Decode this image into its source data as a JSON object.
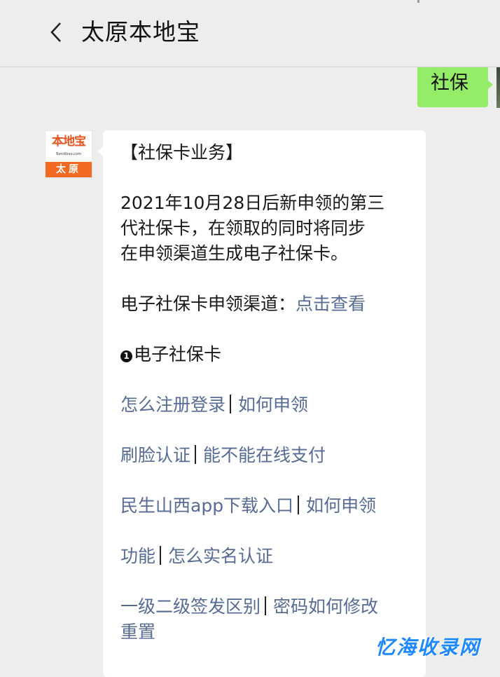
{
  "header": {
    "title": "太原本地宝"
  },
  "chat": {
    "user_message": "社保",
    "bot_avatar": {
      "logo_main": "本地宝",
      "logo_sub": "Bendibao.com",
      "city": "太原"
    },
    "bot_message": {
      "heading": "【社保卡业务】",
      "intro_lines": [
        "2021年10月28日后新申领的第三",
        "代社保卡，在领取的同时将同步",
        "在申领渠道生成电子社保卡。"
      ],
      "channel_label": "电子社保卡申领渠道：",
      "channel_link": "点击查看",
      "section_bullet": "1",
      "section_title": "电子社保卡",
      "links": {
        "how_register": "怎么注册登录",
        "how_apply_1": "如何申领",
        "face_verify": "刷脸认证",
        "online_pay": "能不能在线支付",
        "app_download": "民生山西app下载入口",
        "how_apply_2": "如何申领",
        "features": "功能",
        "realname_verify": "怎么实名认证",
        "level_diff": "一级二级签发区别",
        "password_change_line1": "密码如何修改",
        "password_change_line2": "重置"
      }
    }
  },
  "watermark": "忆海收录网",
  "colors": {
    "background": "#ededed",
    "user_bubble": "#95ec69",
    "link": "#576b95",
    "brand_orange": "#f26a21",
    "watermark": "#1e88ff"
  }
}
